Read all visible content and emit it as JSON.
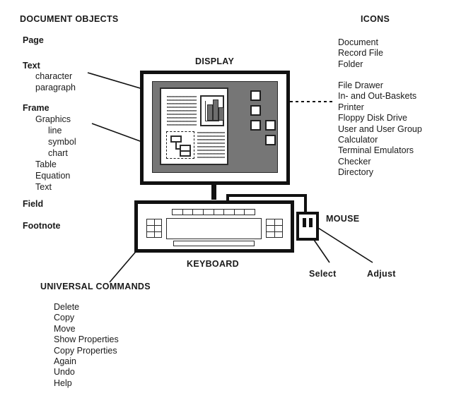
{
  "colors": {
    "ink": "#1a1a1a",
    "outline": "#111111",
    "desktop_gray": "#767676",
    "doc_gray": "#6e6e6e",
    "paper_white": "#ffffff"
  },
  "left_column": {
    "heading": "DOCUMENT OBJECTS",
    "entries": [
      {
        "label": "Page",
        "level": 1
      },
      {
        "label": "Text",
        "level": 1
      },
      {
        "label": "character",
        "level": 2
      },
      {
        "label": "paragraph",
        "level": 2
      },
      {
        "label": "Frame",
        "level": 1
      },
      {
        "label": "Graphics",
        "level": 2
      },
      {
        "label": "line",
        "level": 3
      },
      {
        "label": "symbol",
        "level": 3
      },
      {
        "label": "chart",
        "level": 3
      },
      {
        "label": "Table",
        "level": 2
      },
      {
        "label": "Equation",
        "level": 2
      },
      {
        "label": "Text",
        "level": 2
      },
      {
        "label": "Field",
        "level": 1
      },
      {
        "label": "Footnote",
        "level": 1
      }
    ]
  },
  "universal_commands": {
    "heading": "UNIVERSAL COMMANDS",
    "items": [
      "Delete",
      "Copy",
      "Move",
      "Show Properties",
      "Copy Properties",
      "Again",
      "Undo",
      "Help"
    ]
  },
  "icons_column": {
    "heading": "ICONS",
    "group_one": [
      "Document",
      "Record File",
      "Folder"
    ],
    "group_two": [
      "File Drawer",
      "In- and Out-Baskets",
      "Printer",
      "Floppy Disk Drive",
      "User and User Group",
      "Calculator",
      "Terminal Emulators",
      "Checker",
      "Directory"
    ]
  },
  "hardware": {
    "display_label": "DISPLAY",
    "keyboard_label": "KEYBOARD",
    "mouse_label": "MOUSE",
    "mouse_buttons": {
      "select": "Select",
      "adjust": "Adjust"
    }
  },
  "screen_contents": {
    "document_window": {
      "text_block_label": "paragraph-text-lines",
      "chart_frame_label": "chart-frame",
      "graphics_frame_label": "selected-graphics-frame"
    },
    "desktop_icon_count": 5
  }
}
